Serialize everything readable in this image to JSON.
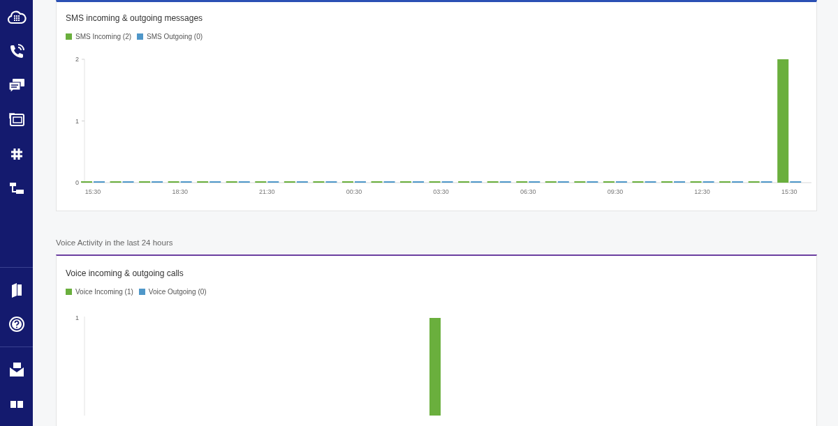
{
  "sidebar": {
    "items": [
      {
        "kind": "cloud"
      },
      {
        "kind": "phone"
      },
      {
        "kind": "chat"
      },
      {
        "kind": "sip"
      },
      {
        "kind": "hash"
      },
      {
        "kind": "flow"
      },
      {
        "kind": "divider"
      },
      {
        "kind": "book"
      },
      {
        "kind": "help"
      },
      {
        "kind": "divider"
      },
      {
        "kind": "mail"
      },
      {
        "kind": "grid"
      }
    ]
  },
  "sms_card": {
    "title": "SMS incoming & outgoing messages",
    "chart_data": {
      "type": "bar",
      "categories": [
        "15:30",
        null,
        null,
        "18:30",
        null,
        null,
        "21:30",
        null,
        null,
        "00:30",
        null,
        null,
        "03:30",
        null,
        null,
        "06:30",
        null,
        null,
        "09:30",
        null,
        null,
        "12:30",
        null,
        null,
        "15:30"
      ],
      "series": [
        {
          "name": "SMS Incoming (2)",
          "color": "#6aaf3d",
          "values": [
            0,
            0,
            0,
            0,
            0,
            0,
            0,
            0,
            0,
            0,
            0,
            0,
            0,
            0,
            0,
            0,
            0,
            0,
            0,
            0,
            0,
            0,
            0,
            0,
            2
          ]
        },
        {
          "name": "SMS Outgoing (0)",
          "color": "#4f97c9",
          "values": [
            0,
            0,
            0,
            0,
            0,
            0,
            0,
            0,
            0,
            0,
            0,
            0,
            0,
            0,
            0,
            0,
            0,
            0,
            0,
            0,
            0,
            0,
            0,
            0,
            0
          ]
        }
      ],
      "ylim": [
        0,
        2
      ],
      "yticks": [
        0,
        1,
        2
      ]
    }
  },
  "voice_section": {
    "heading": "Voice Activity in the last 24 hours"
  },
  "voice_card": {
    "title": "Voice incoming & outgoing calls",
    "legend": [
      {
        "label": "Voice Incoming (1)",
        "color": "#6aaf3d"
      },
      {
        "label": "Voice Outgoing (0)",
        "color": "#4f97c9"
      }
    ],
    "y_tick": "1"
  }
}
